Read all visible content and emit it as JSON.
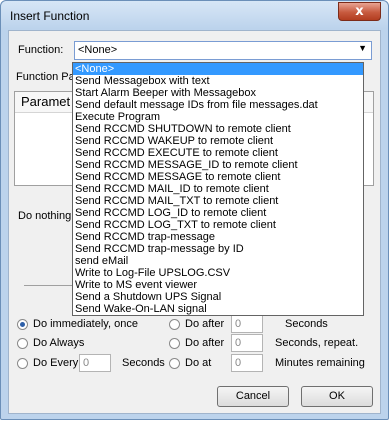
{
  "window": {
    "title": "Insert Function",
    "close_glyph": "x"
  },
  "function_label": "Function:",
  "function_value": "<None>",
  "function_params_label": "Function Pa",
  "params_header": "Paramet",
  "do_nothing_label": "Do nothing",
  "dropdown_items": [
    "<None>",
    "Send Messagebox with text",
    "Start Alarm Beeper with Messagebox",
    "Send default message IDs from file messages.dat",
    "Execute Program",
    "Send RCCMD SHUTDOWN to remote client",
    "Send RCCMD WAKEUP to remote client",
    "Send RCCMD EXECUTE to remote client",
    "Send RCCMD MESSAGE_ID to remote client",
    "Send RCCMD MESSAGE to remote client",
    "Send RCCMD MAIL_ID to remote client",
    "Send RCCMD MAIL_TXT to remote client",
    "Send RCCMD LOG_ID to remote client",
    "Send RCCMD LOG_TXT to remote client",
    "Send RCCMD trap-message",
    "Send RCCMD trap-message by ID",
    "send eMail",
    "Write to Log-File UPSLOG.CSV",
    "Write to MS event viewer",
    "Send a Shutdown UPS Signal",
    "Send Wake-On-LAN signal"
  ],
  "schedule": {
    "immediately": "Do immediately, once",
    "always": "Do Always",
    "every": "Do Every",
    "every_value": "0",
    "every_unit": "Seconds",
    "after1": "Do after",
    "after1_value": "0",
    "after1_unit": "Seconds",
    "after2": "Do after",
    "after2_value": "0",
    "after2_unit": "Seconds, repeat.",
    "at": "Do at",
    "at_value": "0",
    "at_unit": "Minutes remaining"
  },
  "buttons": {
    "cancel": "Cancel",
    "ok": "OK"
  },
  "icons": {
    "close": "close-icon",
    "dropdown_arrow": "chevron-down-icon"
  },
  "colors": {
    "selection": "#3399ff",
    "close_button": "#c75a3f",
    "frame": "#bcd3ec"
  }
}
